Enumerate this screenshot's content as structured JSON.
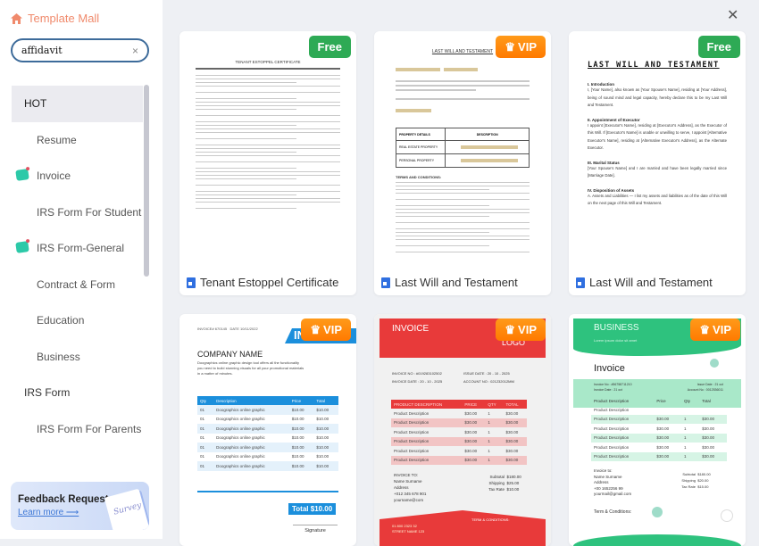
{
  "sidebar": {
    "brand": "Template Mall",
    "search": {
      "value": "affidavit",
      "clear": "×"
    },
    "items": [
      {
        "label": "HOT",
        "top": true,
        "active": true
      },
      {
        "label": "Resume"
      },
      {
        "label": "Invoice",
        "icon": true
      },
      {
        "label": "IRS Form For Student"
      },
      {
        "label": "IRS Form-General",
        "icon": true
      },
      {
        "label": "Contract & Form"
      },
      {
        "label": "Education"
      },
      {
        "label": "Business"
      },
      {
        "label": "IRS Form",
        "top": true
      },
      {
        "label": "IRS Form For Parents"
      }
    ],
    "feedback": {
      "title": "Feedback Request",
      "link": "Learn more ⟶",
      "art": "Survey"
    }
  },
  "close": "✕",
  "colors": {
    "free": "#2eaa55",
    "vip": "#ff8000",
    "accent_brand": "#f08a6c"
  },
  "cards": [
    {
      "title": "Tenant Estoppel Certificate",
      "badge": "Free",
      "heading": "TENANT ESTOPPEL CERTIFICATE"
    },
    {
      "title": "Last Will and Testament",
      "badge": "VIP",
      "heading": "LAST WILL AND TESTAMENT",
      "table_headers": [
        "PROPERTY DETAILS",
        "DESCRIPTION"
      ],
      "table_rows": [
        "REAL ESTATE PROPERTY",
        "PERSONAL PROPERTY"
      ],
      "section": "TERMS AND CONDITIONS:"
    },
    {
      "title": "Last Will and Testament",
      "badge": "Free",
      "heading": "LAST WILL AND TESTAMENT",
      "sections": [
        {
          "h": "I. Introduction",
          "p": "I, [Your Name], also known as [Your Spouse's Name], residing at [Your Address], being of sound mind and legal capacity, hereby declare this to be my Last Will and Testament."
        },
        {
          "h": "II. Appointment of Executor",
          "p": "I appoint [Executor's Name], residing at [Executor's Address], as the Executor of this Will. If [Executor's Name] is unable or unwilling to serve, I appoint [Alternative Executor's Name], residing at [Alternative Executor's Address], as the Alternate Executor."
        },
        {
          "h": "III. Marital Status",
          "p": "[Your Spouse's Name] and I are married and have been legally married since [Marriage Date]."
        },
        {
          "h": "IV. Disposition of Assets",
          "p": "A. Assets and Liabilities — I list my assets and liabilities as of the date of this Will on the next page of this Will and Testament."
        }
      ]
    },
    {
      "badge": "VIP",
      "invoice_no": "INVOICE# 670145",
      "date": "DATE 10/11/2022",
      "banner": "INVOICE",
      "company": "COMPANY NAME",
      "blurb": "Doographics online graphic design tool offers all the functionality you need to build stunning visuals for all your promotional materials in a matter of minutes.",
      "headers": [
        "Qty",
        "Description",
        "Price",
        "Total"
      ],
      "rows": [
        [
          "01",
          "Doographics online graphic",
          "$10.00",
          "$10.00"
        ],
        [
          "01",
          "Doographics online graphic",
          "$10.00",
          "$10.00"
        ],
        [
          "01",
          "Doographics online graphic",
          "$10.00",
          "$10.00"
        ],
        [
          "01",
          "Doographics online graphic",
          "$10.00",
          "$10.00"
        ],
        [
          "01",
          "Doographics online graphic",
          "$10.00",
          "$10.00"
        ],
        [
          "01",
          "Doographics online graphic",
          "$10.00",
          "$10.00"
        ],
        [
          "01",
          "Doographics online graphic",
          "$10.00",
          "$10.00"
        ]
      ],
      "total": "Total  $10.00",
      "signature": "Signature"
    },
    {
      "badge": "VIP",
      "heading": "INVOICE",
      "logo": "LOGO",
      "invoice_no": "INVOICE NO : #019283102502",
      "issue": "ISSUE DATE : 20 - 10 - 2025",
      "date": "INVOICE DATE : 20 - 10 - 2025",
      "account": "ACCOUNT NO : 021232012MM",
      "headers": [
        "PRODUCT DESCRIPTION",
        "PRICE",
        "QTY",
        "TOTAL"
      ],
      "rows": [
        [
          "Product Description",
          "$30.00",
          "1",
          "$30.00"
        ],
        [
          "Product Description",
          "$30.00",
          "1",
          "$30.00"
        ],
        [
          "Product Description",
          "$30.00",
          "1",
          "$30.00"
        ],
        [
          "Product Description",
          "$30.00",
          "1",
          "$30.00"
        ],
        [
          "Product Description",
          "$30.00",
          "1",
          "$30.00"
        ],
        [
          "Product Description",
          "$30.00",
          "1",
          "$30.00"
        ]
      ],
      "to": "INVOICE TO:",
      "to_lines": [
        "Name Surname",
        "Address",
        "+012 345 678 901",
        "yourname@com"
      ],
      "sums": [
        [
          "Subtotal",
          "$180.00"
        ],
        [
          "Shipping",
          "$25.00"
        ],
        [
          "Tax Rate",
          "$10.00"
        ]
      ],
      "terms": "TERM & CONDITIONS:",
      "footer": [
        "01 800 2323 32",
        "STREET NAME 123"
      ]
    },
    {
      "badge": "VIP",
      "heading": "BUSINESS",
      "sub": "Lorem ipsum dolor sit amet",
      "invoice": "Invoice",
      "invoice_no": "Invoice No : #56758711210",
      "issue": "Issue Date : 21 oct",
      "date": "Invoice Date : 21 oct",
      "account": "Account No : 0012536011",
      "headers": [
        "Product Description",
        "Price",
        "Qty",
        "Total"
      ],
      "rows": [
        [
          "Product Description",
          "",
          "",
          ""
        ],
        [
          "Product Description",
          "$30.00",
          "1",
          "$30.00"
        ],
        [
          "Product Description",
          "$30.00",
          "1",
          "$30.00"
        ],
        [
          "Product Description",
          "$30.00",
          "1",
          "$30.00"
        ],
        [
          "Product Description",
          "$30.00",
          "1",
          "$30.00"
        ],
        [
          "Product Description",
          "$30.00",
          "1",
          "$30.00"
        ]
      ],
      "to": "Invoice to:",
      "to_lines": [
        "Name Surname",
        "Address",
        "+00 1652256 99",
        "yourmail@gmail.com"
      ],
      "sums": [
        [
          "Subtotal",
          "$180.00"
        ],
        [
          "Shipping",
          "$20.00"
        ],
        [
          "Tax Rate",
          "$15.00"
        ]
      ],
      "terms": "Term & Conditions:"
    }
  ]
}
